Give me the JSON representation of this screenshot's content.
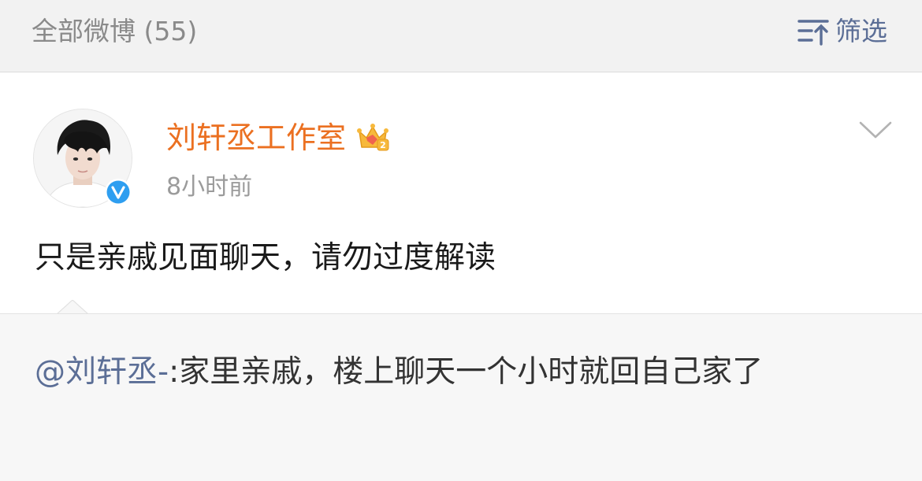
{
  "header": {
    "title": "全部微博 (55)",
    "filter_label": "筛选",
    "filter_icon": "sort-filter-icon"
  },
  "post": {
    "author": "刘轩丞工作室",
    "author_color": "#eb7021",
    "badge_icon": "crown-member-icon",
    "verified_icon": "verified-v-icon",
    "timestamp": "8小时前",
    "text": "只是亲戚见面聊天，请勿过度解读",
    "menu_icon": "chevron-down-icon"
  },
  "quote": {
    "mention": "@刘轩丞-",
    "text": ":家里亲戚，楼上聊天一个小时就回自己家了",
    "mention_color": "#5b6e96"
  }
}
